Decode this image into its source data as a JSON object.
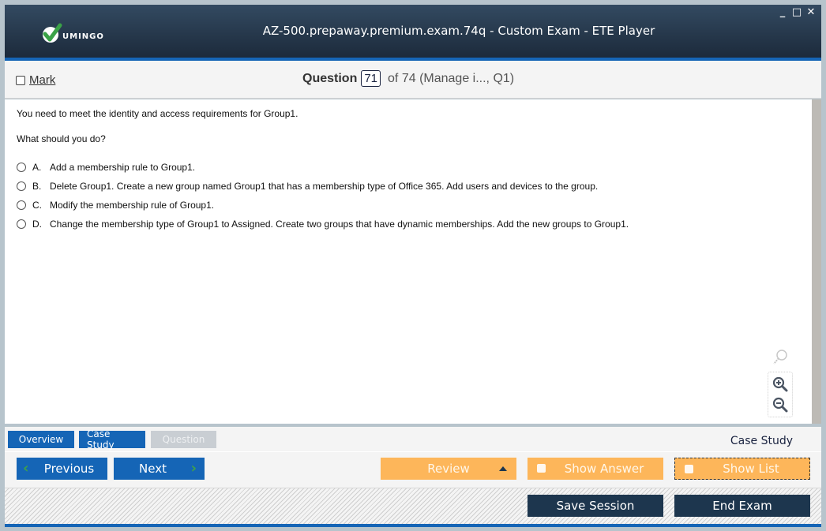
{
  "window": {
    "title": "AZ-500.prepaway.premium.exam.74q - Custom Exam - ETE Player",
    "logo_text": "UMINGO",
    "controls": {
      "minimize": "_",
      "maximize": "□",
      "close": "✕"
    }
  },
  "question_header": {
    "mark_label": "Mark",
    "question_label": "Question",
    "question_number": "71",
    "of_text": "of 74 (Manage i..., Q1)"
  },
  "question": {
    "intro": "You need to meet the identity and access requirements for Group1.",
    "prompt": "What should you do?",
    "options": [
      {
        "letter": "A.",
        "text": "Add a membership rule to Group1."
      },
      {
        "letter": "B.",
        "text": "Delete Group1. Create a new group named Group1 that has a membership type of Office 365. Add users and devices to the group."
      },
      {
        "letter": "C.",
        "text": "Modify the membership rule of Group1."
      },
      {
        "letter": "D.",
        "text": "Change the membership type of Group1 to Assigned. Create two groups that have dynamic memberships. Add the new groups to Group1."
      }
    ]
  },
  "zoom_tools": {
    "find_icon": "magnifier-icon",
    "zoom_in_icon": "zoom-in-icon",
    "zoom_out_icon": "zoom-out-icon"
  },
  "tabs": [
    {
      "label": "Overview",
      "state": "active"
    },
    {
      "label": "Case Study",
      "state": "active"
    },
    {
      "label": "Question",
      "state": "disabled"
    }
  ],
  "section_label": "Case Study",
  "nav": {
    "previous": "Previous",
    "next": "Next",
    "review": "Review",
    "show_answer": "Show Answer",
    "show_list": "Show List"
  },
  "footer": {
    "save_session": "Save Session",
    "end_exam": "End Exam"
  },
  "colors": {
    "title_bg": "#1c2a3b",
    "accent_blue": "#1565b6",
    "orange": "#fdb65a",
    "dark_button": "#1d364e",
    "chevron_green": "#3fa14a"
  }
}
